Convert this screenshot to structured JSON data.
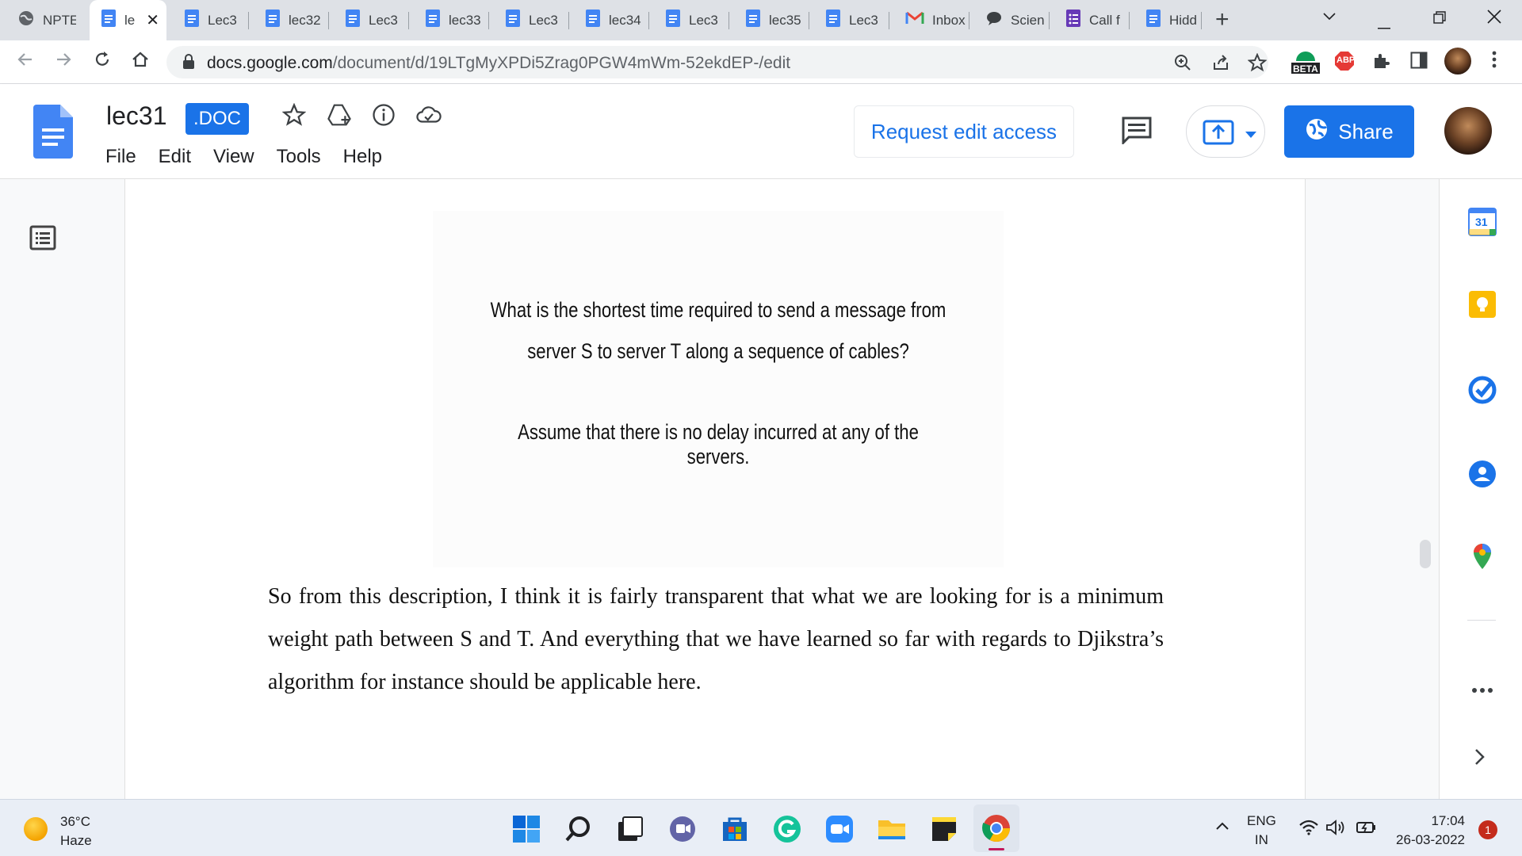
{
  "browser": {
    "tabs": [
      {
        "label": "NPTE",
        "icon": "globe-icon"
      },
      {
        "label": "le",
        "icon": "docs-icon",
        "active": true
      },
      {
        "label": "Lec3",
        "icon": "docs-icon"
      },
      {
        "label": "lec32",
        "icon": "docs-icon"
      },
      {
        "label": "Lec3",
        "icon": "docs-icon"
      },
      {
        "label": "lec33",
        "icon": "docs-icon"
      },
      {
        "label": "Lec3",
        "icon": "docs-icon"
      },
      {
        "label": "lec34",
        "icon": "docs-icon"
      },
      {
        "label": "Lec3",
        "icon": "docs-icon"
      },
      {
        "label": "lec35",
        "icon": "docs-icon"
      },
      {
        "label": "Lec3",
        "icon": "docs-icon"
      },
      {
        "label": "Inbox",
        "icon": "gmail-icon"
      },
      {
        "label": "Scien",
        "icon": "chat-icon"
      },
      {
        "label": "Call f",
        "icon": "forms-icon"
      },
      {
        "label": "Hidd",
        "icon": "docs-icon"
      }
    ],
    "url_domain": "docs.google.com",
    "url_path": "/document/d/19LTgMyXPDi5Zrag0PGW4mWm-52ekdEP-/edit",
    "beta_label": "BETA",
    "abp_label": "ABP"
  },
  "docs": {
    "title": "lec31",
    "badge": ".DOC",
    "menu": [
      "File",
      "Edit",
      "View",
      "Tools",
      "Help"
    ],
    "request_edit_label": "Request edit access",
    "share_label": "Share"
  },
  "document": {
    "slide_lines": [
      "What is the shortest time required to send a message from",
      "server S to server T along a sequence of cables?",
      "Assume that there is no delay incurred at any of the servers."
    ],
    "paragraph": "So from this description, I think it is fairly transparent that what we are looking for is a minimum weight path between S and T. And everything that we have learned so far with regards to Djikstra’s algorithm for instance should be applicable here."
  },
  "side_panel": {
    "calendar_day": "31"
  },
  "taskbar": {
    "temperature": "36°C",
    "weather": "Haze",
    "lang_1": "ENG",
    "lang_2": "IN",
    "time": "17:04",
    "date": "26-03-2022",
    "notifications": "1"
  },
  "colors": {
    "accent": "#1a73e8",
    "docs_blue": "#4285f4",
    "tab_strip": "#dee1e6",
    "taskbar": "#e9eef6"
  }
}
